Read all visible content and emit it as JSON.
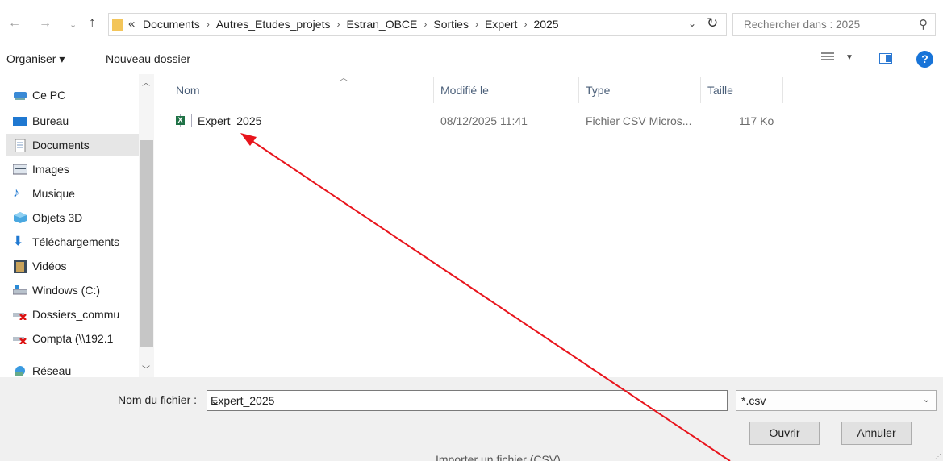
{
  "address": {
    "chevron": "«",
    "breadcrumbs": [
      "Documents",
      "Autres_Etudes_projets",
      "Estran_OBCE",
      "Sorties",
      "Expert",
      "2025"
    ],
    "separator": "›"
  },
  "search": {
    "placeholder": "Rechercher dans : 2025"
  },
  "toolbar": {
    "organize": "Organiser ▾",
    "new_folder": "Nouveau dossier",
    "help": "?"
  },
  "sidebar": {
    "items": [
      {
        "label": "Ce PC",
        "icon": "computer-icon"
      },
      {
        "label": "Bureau",
        "icon": "desktop-icon"
      },
      {
        "label": "Documents",
        "icon": "documents-icon",
        "selected": true
      },
      {
        "label": "Images",
        "icon": "images-icon"
      },
      {
        "label": "Musique",
        "icon": "music-icon"
      },
      {
        "label": "Objets 3D",
        "icon": "objects-3d-icon"
      },
      {
        "label": "Téléchargements",
        "icon": "downloads-icon"
      },
      {
        "label": "Vidéos",
        "icon": "videos-icon"
      },
      {
        "label": "Windows (C:)",
        "icon": "drive-icon"
      },
      {
        "label": "Dossiers_commu",
        "icon": "network-drive-disconnected-icon"
      },
      {
        "label": "Compta (\\\\192.1",
        "icon": "network-drive-disconnected-icon"
      },
      {
        "label": "Réseau",
        "icon": "network-icon"
      }
    ]
  },
  "columns": {
    "name": "Nom",
    "modified": "Modifié le",
    "type": "Type",
    "size": "Taille"
  },
  "files": [
    {
      "name": "Expert_2025",
      "modified": "08/12/2025 11:41",
      "type": "Fichier CSV Micros...",
      "size": "117 Ko",
      "icon": "excel-csv-icon"
    }
  ],
  "bottom": {
    "filename_label": "Nom du fichier :",
    "filename_value": "Expert_2025",
    "filter_value": "*.csv",
    "open_label": "Ouvrir",
    "cancel_label": "Annuler"
  },
  "background_text": "Importer un fichier (CSV)",
  "colors": {
    "accent": "#1874d8",
    "selection": "#e6e6e6",
    "annotation_arrow": "#e8141c"
  }
}
